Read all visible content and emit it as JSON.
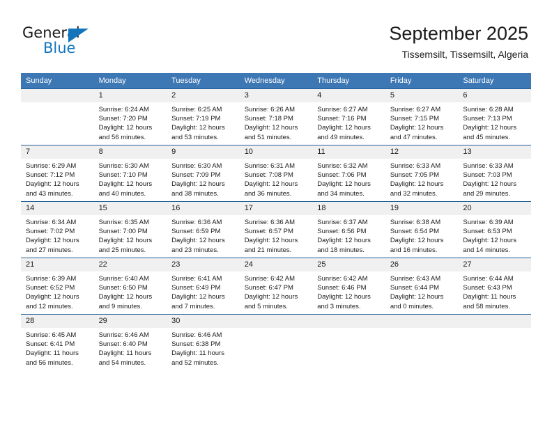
{
  "brand": {
    "name_top": "General",
    "name_bottom": "Blue",
    "accent_color": "#1275bc"
  },
  "header": {
    "title": "September 2025",
    "subtitle": "Tissemsilt, Tissemsilt, Algeria"
  },
  "theme": {
    "header_row_blue": "#3d77b4",
    "row_divider_blue": "#215e96",
    "daynum_band": "#f0f0f0"
  },
  "weekday_headers": [
    "Sunday",
    "Monday",
    "Tuesday",
    "Wednesday",
    "Thursday",
    "Friday",
    "Saturday"
  ],
  "weeks": [
    [
      {
        "day": "",
        "lines": []
      },
      {
        "day": "1",
        "lines": [
          "Sunrise: 6:24 AM",
          "Sunset: 7:20 PM",
          "Daylight: 12 hours",
          "and 56 minutes."
        ]
      },
      {
        "day": "2",
        "lines": [
          "Sunrise: 6:25 AM",
          "Sunset: 7:19 PM",
          "Daylight: 12 hours",
          "and 53 minutes."
        ]
      },
      {
        "day": "3",
        "lines": [
          "Sunrise: 6:26 AM",
          "Sunset: 7:18 PM",
          "Daylight: 12 hours",
          "and 51 minutes."
        ]
      },
      {
        "day": "4",
        "lines": [
          "Sunrise: 6:27 AM",
          "Sunset: 7:16 PM",
          "Daylight: 12 hours",
          "and 49 minutes."
        ]
      },
      {
        "day": "5",
        "lines": [
          "Sunrise: 6:27 AM",
          "Sunset: 7:15 PM",
          "Daylight: 12 hours",
          "and 47 minutes."
        ]
      },
      {
        "day": "6",
        "lines": [
          "Sunrise: 6:28 AM",
          "Sunset: 7:13 PM",
          "Daylight: 12 hours",
          "and 45 minutes."
        ]
      }
    ],
    [
      {
        "day": "7",
        "lines": [
          "Sunrise: 6:29 AM",
          "Sunset: 7:12 PM",
          "Daylight: 12 hours",
          "and 43 minutes."
        ]
      },
      {
        "day": "8",
        "lines": [
          "Sunrise: 6:30 AM",
          "Sunset: 7:10 PM",
          "Daylight: 12 hours",
          "and 40 minutes."
        ]
      },
      {
        "day": "9",
        "lines": [
          "Sunrise: 6:30 AM",
          "Sunset: 7:09 PM",
          "Daylight: 12 hours",
          "and 38 minutes."
        ]
      },
      {
        "day": "10",
        "lines": [
          "Sunrise: 6:31 AM",
          "Sunset: 7:08 PM",
          "Daylight: 12 hours",
          "and 36 minutes."
        ]
      },
      {
        "day": "11",
        "lines": [
          "Sunrise: 6:32 AM",
          "Sunset: 7:06 PM",
          "Daylight: 12 hours",
          "and 34 minutes."
        ]
      },
      {
        "day": "12",
        "lines": [
          "Sunrise: 6:33 AM",
          "Sunset: 7:05 PM",
          "Daylight: 12 hours",
          "and 32 minutes."
        ]
      },
      {
        "day": "13",
        "lines": [
          "Sunrise: 6:33 AM",
          "Sunset: 7:03 PM",
          "Daylight: 12 hours",
          "and 29 minutes."
        ]
      }
    ],
    [
      {
        "day": "14",
        "lines": [
          "Sunrise: 6:34 AM",
          "Sunset: 7:02 PM",
          "Daylight: 12 hours",
          "and 27 minutes."
        ]
      },
      {
        "day": "15",
        "lines": [
          "Sunrise: 6:35 AM",
          "Sunset: 7:00 PM",
          "Daylight: 12 hours",
          "and 25 minutes."
        ]
      },
      {
        "day": "16",
        "lines": [
          "Sunrise: 6:36 AM",
          "Sunset: 6:59 PM",
          "Daylight: 12 hours",
          "and 23 minutes."
        ]
      },
      {
        "day": "17",
        "lines": [
          "Sunrise: 6:36 AM",
          "Sunset: 6:57 PM",
          "Daylight: 12 hours",
          "and 21 minutes."
        ]
      },
      {
        "day": "18",
        "lines": [
          "Sunrise: 6:37 AM",
          "Sunset: 6:56 PM",
          "Daylight: 12 hours",
          "and 18 minutes."
        ]
      },
      {
        "day": "19",
        "lines": [
          "Sunrise: 6:38 AM",
          "Sunset: 6:54 PM",
          "Daylight: 12 hours",
          "and 16 minutes."
        ]
      },
      {
        "day": "20",
        "lines": [
          "Sunrise: 6:39 AM",
          "Sunset: 6:53 PM",
          "Daylight: 12 hours",
          "and 14 minutes."
        ]
      }
    ],
    [
      {
        "day": "21",
        "lines": [
          "Sunrise: 6:39 AM",
          "Sunset: 6:52 PM",
          "Daylight: 12 hours",
          "and 12 minutes."
        ]
      },
      {
        "day": "22",
        "lines": [
          "Sunrise: 6:40 AM",
          "Sunset: 6:50 PM",
          "Daylight: 12 hours",
          "and 9 minutes."
        ]
      },
      {
        "day": "23",
        "lines": [
          "Sunrise: 6:41 AM",
          "Sunset: 6:49 PM",
          "Daylight: 12 hours",
          "and 7 minutes."
        ]
      },
      {
        "day": "24",
        "lines": [
          "Sunrise: 6:42 AM",
          "Sunset: 6:47 PM",
          "Daylight: 12 hours",
          "and 5 minutes."
        ]
      },
      {
        "day": "25",
        "lines": [
          "Sunrise: 6:42 AM",
          "Sunset: 6:46 PM",
          "Daylight: 12 hours",
          "and 3 minutes."
        ]
      },
      {
        "day": "26",
        "lines": [
          "Sunrise: 6:43 AM",
          "Sunset: 6:44 PM",
          "Daylight: 12 hours",
          "and 0 minutes."
        ]
      },
      {
        "day": "27",
        "lines": [
          "Sunrise: 6:44 AM",
          "Sunset: 6:43 PM",
          "Daylight: 11 hours",
          "and 58 minutes."
        ]
      }
    ],
    [
      {
        "day": "28",
        "lines": [
          "Sunrise: 6:45 AM",
          "Sunset: 6:41 PM",
          "Daylight: 11 hours",
          "and 56 minutes."
        ]
      },
      {
        "day": "29",
        "lines": [
          "Sunrise: 6:46 AM",
          "Sunset: 6:40 PM",
          "Daylight: 11 hours",
          "and 54 minutes."
        ]
      },
      {
        "day": "30",
        "lines": [
          "Sunrise: 6:46 AM",
          "Sunset: 6:38 PM",
          "Daylight: 11 hours",
          "and 52 minutes."
        ]
      },
      {
        "day": "",
        "lines": []
      },
      {
        "day": "",
        "lines": []
      },
      {
        "day": "",
        "lines": []
      },
      {
        "day": "",
        "lines": []
      }
    ]
  ]
}
